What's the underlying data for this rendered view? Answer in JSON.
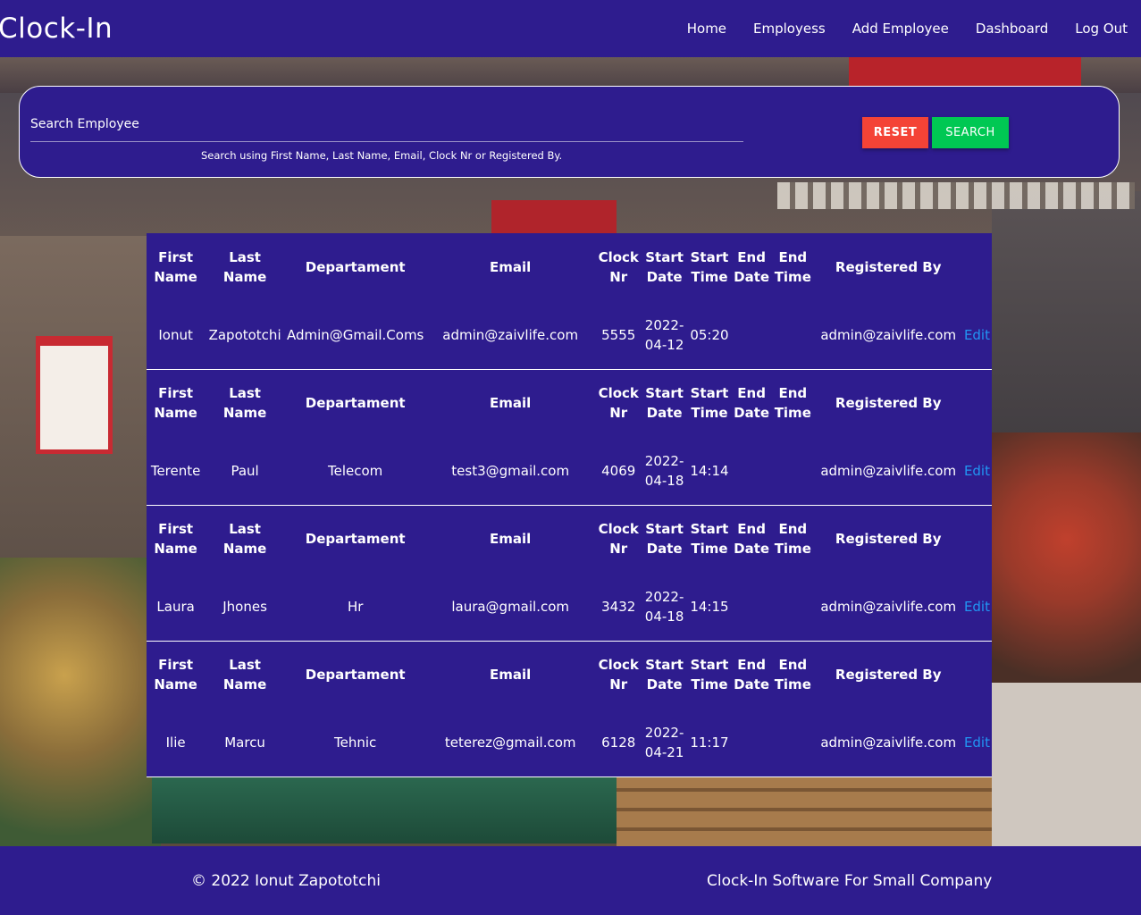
{
  "brand": "Clock-In",
  "nav": [
    "Home",
    "Employess",
    "Add Employee",
    "Dashboard",
    "Log Out"
  ],
  "search": {
    "placeholder": "Search Employee",
    "hint": "Search using First Name, Last Name, Email, Clock Nr or Registered By.",
    "reset_label": "RESET",
    "search_label": "SEARCH"
  },
  "table": {
    "headers": [
      "First Name",
      "Last Name",
      "Departament",
      "Email",
      "Clock Nr",
      "Start Date",
      "Start Time",
      "End Date",
      "End Time",
      "Registered By"
    ],
    "edit_label": "Edit",
    "rows": [
      {
        "first": "Ionut",
        "last": "Zapototchi",
        "dept": "Admin@Gmail.Coms",
        "email": "admin@zaivlife.com",
        "clock": "5555",
        "start_date": "2022-04-12",
        "start_time": "05:20",
        "end_date": "",
        "end_time": "",
        "registered_by": "admin@zaivlife.com"
      },
      {
        "first": "Terente",
        "last": "Paul",
        "dept": "Telecom",
        "email": "test3@gmail.com",
        "clock": "4069",
        "start_date": "2022-04-18",
        "start_time": "14:14",
        "end_date": "",
        "end_time": "",
        "registered_by": "admin@zaivlife.com"
      },
      {
        "first": "Laura",
        "last": "Jhones",
        "dept": "Hr",
        "email": "laura@gmail.com",
        "clock": "3432",
        "start_date": "2022-04-18",
        "start_time": "14:15",
        "end_date": "",
        "end_time": "",
        "registered_by": "admin@zaivlife.com"
      },
      {
        "first": "Ilie",
        "last": "Marcu",
        "dept": "Tehnic",
        "email": "teterez@gmail.com",
        "clock": "6128",
        "start_date": "2022-04-21",
        "start_time": "11:17",
        "end_date": "",
        "end_time": "",
        "registered_by": "admin@zaivlife.com"
      }
    ]
  },
  "footer": {
    "copyright": "© 2022 Ionut Zapototchi",
    "tagline": "Clock-In Software For Small Company"
  },
  "colors": {
    "primary": "#2e1c8e",
    "reset": "#f44336",
    "search": "#00c853",
    "link": "#2196f3"
  }
}
